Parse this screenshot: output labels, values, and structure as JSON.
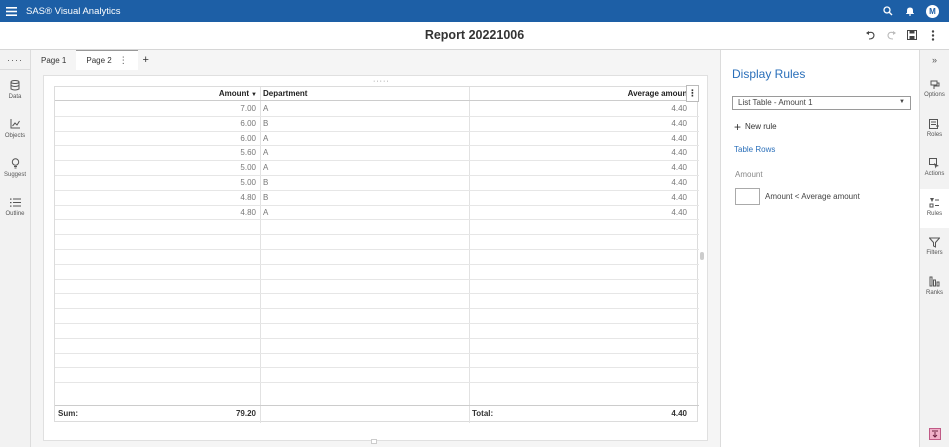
{
  "app": {
    "title": "SAS® Visual Analytics",
    "avatar_initial": "M"
  },
  "report": {
    "title": "Report 20221006"
  },
  "left_rail": {
    "dots": "····",
    "items": [
      {
        "label": "Data",
        "icon": "database-icon"
      },
      {
        "label": "Objects",
        "icon": "chart-line-icon"
      },
      {
        "label": "Suggest",
        "icon": "lightbulb-icon"
      },
      {
        "label": "Outline",
        "icon": "list-icon"
      }
    ]
  },
  "tabs": [
    {
      "label": "Page 1"
    },
    {
      "label": "Page 2",
      "kebab": "⋮"
    }
  ],
  "tab_add": "+",
  "table": {
    "grip": "·····",
    "menu": "⋮",
    "columns": {
      "amount": "Amount",
      "amount_sort": "▼",
      "department": "Department",
      "average": "Average amount"
    },
    "rows": [
      {
        "amount": "7.00",
        "department": "A",
        "average": "4.40"
      },
      {
        "amount": "6.00",
        "department": "B",
        "average": "4.40"
      },
      {
        "amount": "6.00",
        "department": "A",
        "average": "4.40"
      },
      {
        "amount": "5.60",
        "department": "A",
        "average": "4.40"
      },
      {
        "amount": "5.00",
        "department": "A",
        "average": "4.40"
      },
      {
        "amount": "5.00",
        "department": "B",
        "average": "4.40"
      },
      {
        "amount": "4.80",
        "department": "B",
        "average": "4.40"
      },
      {
        "amount": "4.80",
        "department": "A",
        "average": "4.40"
      }
    ],
    "footer": {
      "sum_label": "Sum:",
      "sum_value": "79.20",
      "total_label": "Total:",
      "total_value": "4.40"
    }
  },
  "display_rules": {
    "title": "Display Rules",
    "selected_object": "List Table - Amount 1",
    "new_rule": "New rule",
    "table_rows": "Table Rows",
    "section": "Amount",
    "rule_text": "Amount < Average amount"
  },
  "right_rail": {
    "collapse": "»",
    "items": [
      {
        "label": "Options",
        "icon": "paint-icon"
      },
      {
        "label": "Roles",
        "icon": "roles-icon"
      },
      {
        "label": "Actions",
        "icon": "actions-icon"
      },
      {
        "label": "Rules",
        "icon": "rules-icon"
      },
      {
        "label": "Filters",
        "icon": "filter-icon"
      },
      {
        "label": "Ranks",
        "icon": "ranks-icon"
      }
    ]
  }
}
